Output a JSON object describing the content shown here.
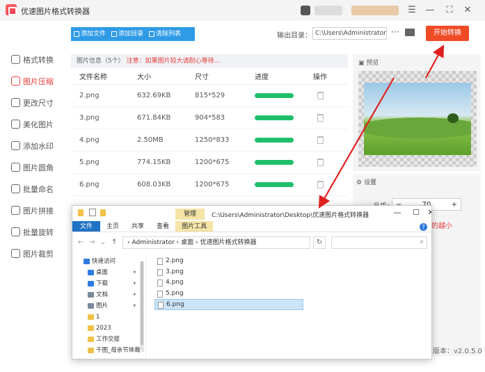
{
  "app": {
    "title": "优速图片格式转换器"
  },
  "window_controls": {
    "menu": "☰",
    "minimize": "—",
    "maximize": "⛶",
    "close": "✕"
  },
  "sidebar": {
    "items": [
      {
        "label": "格式转换",
        "icon": "format-convert-icon"
      },
      {
        "label": "图片压缩",
        "icon": "compress-icon",
        "active": true
      },
      {
        "label": "更改尺寸",
        "icon": "resize-icon"
      },
      {
        "label": "美化图片",
        "icon": "beautify-icon"
      },
      {
        "label": "添加水印",
        "icon": "watermark-icon"
      },
      {
        "label": "图片圆角",
        "icon": "round-corner-icon"
      },
      {
        "label": "批量命名",
        "icon": "rename-icon"
      },
      {
        "label": "图片拼接",
        "icon": "stitch-icon"
      },
      {
        "label": "批量旋转",
        "icon": "rotate-icon"
      },
      {
        "label": "图片裁剪",
        "icon": "crop-icon"
      }
    ]
  },
  "toolbar": {
    "add_file": "添加文件",
    "add_folder": "添加目录",
    "clear_list": "清除列表",
    "output_label": "输出目录：",
    "output_path": "C:\\Users\\Administrator",
    "more": "···",
    "start": "开始转换"
  },
  "file_panel": {
    "info": "图片信息（5个）",
    "warning": "注意：如果图片较大请耐心等待...",
    "columns": [
      "文件名称",
      "大小",
      "尺寸",
      "进度",
      "操作"
    ],
    "rows": [
      {
        "name": "2.png",
        "size": "632.69KB",
        "dim": "815*529",
        "progress": 1.0
      },
      {
        "name": "3.png",
        "size": "671.84KB",
        "dim": "904*583",
        "progress": 1.0
      },
      {
        "name": "4.png",
        "size": "2.50MB",
        "dim": "1250*833",
        "progress": 1.0
      },
      {
        "name": "5.png",
        "size": "774.15KB",
        "dim": "1200*675",
        "progress": 1.0
      },
      {
        "name": "6.png",
        "size": "608.03KB",
        "dim": "1200*675",
        "progress": 1.0
      }
    ]
  },
  "preview": {
    "label": "预览"
  },
  "settings": {
    "label": "设置",
    "quality_label": "品质：",
    "quality_value": "70",
    "minus": "−",
    "plus": "+",
    "hint": "的越小",
    "info": "?"
  },
  "version": "版本：v2.0.5.0",
  "explorer": {
    "manage_tab": "管理",
    "title_path": "C:\\Users\\Administrator\\Desktop\\优速图片格式转换器",
    "ribbon_tabs": [
      "文件",
      "主页",
      "共享",
      "查看",
      "图片工具"
    ],
    "address": "› Administrator  ›  桌面  ›  优速图片格式转换器",
    "nav_items": [
      {
        "label": "快速访问",
        "icon": "star-icon",
        "color": "#2f7be0",
        "pinned": false,
        "top": true
      },
      {
        "label": "桌面",
        "icon": "desktop-icon",
        "color": "#2f7be0",
        "pinned": true
      },
      {
        "label": "下载",
        "icon": "download-icon",
        "color": "#2f7be0",
        "pinned": true
      },
      {
        "label": "文档",
        "icon": "document-icon",
        "color": "#7a8a9a",
        "pinned": true
      },
      {
        "label": "图片",
        "icon": "picture-icon",
        "color": "#7a8a9a",
        "pinned": true
      },
      {
        "label": "1",
        "icon": "folder-icon",
        "color": "#f0c24a",
        "pinned": false
      },
      {
        "label": "2023",
        "icon": "folder-icon",
        "color": "#f0c24a",
        "pinned": false
      },
      {
        "label": "工作交接",
        "icon": "folder-icon",
        "color": "#f0c24a",
        "pinned": false
      },
      {
        "label": "千图_母亲节体裁",
        "icon": "folder-icon",
        "color": "#f0c24a",
        "pinned": false
      }
    ],
    "files": [
      "2.png",
      "3.png",
      "4.png",
      "5.png",
      "6.png"
    ],
    "selected_file": "6.png"
  },
  "colors": {
    "accent_red": "#f04b27",
    "toolbar_blue": "#2f9be6",
    "progress_green": "#1fbf6a",
    "annotation_arrow": "#e02020"
  }
}
